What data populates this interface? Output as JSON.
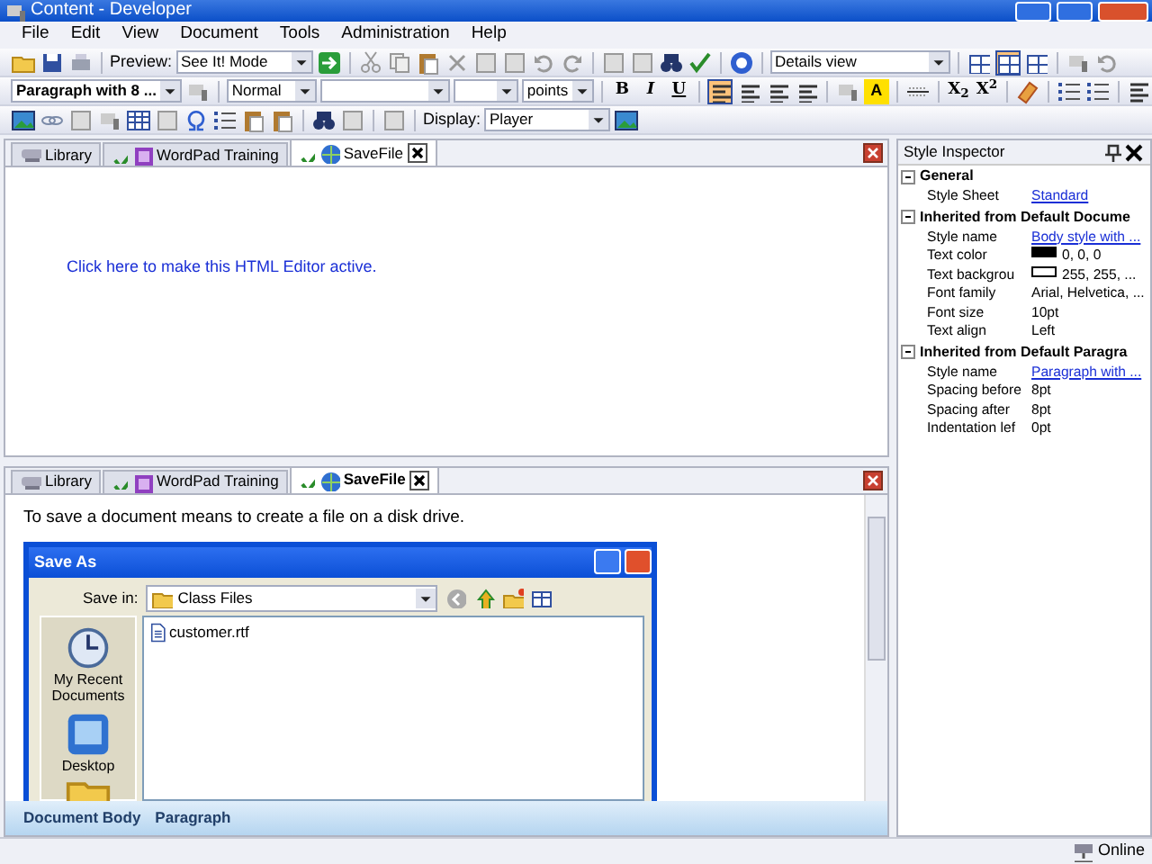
{
  "window": {
    "title": "Content - Developer"
  },
  "menu": [
    "File",
    "Edit",
    "View",
    "Document",
    "Tools",
    "Administration",
    "Help"
  ],
  "toolbar": {
    "preview_label": "Preview:",
    "preview_mode": "See It! Mode",
    "view_select": "Details view",
    "layout_buttons": [
      {
        "selected": false
      },
      {
        "selected": true
      },
      {
        "selected": false
      }
    ]
  },
  "format_bar": {
    "paragraph_style": "Paragraph with 8 ...",
    "style": "Normal",
    "unit": "points",
    "format_buttons": [
      "B",
      "I",
      "U"
    ],
    "align_buttons": [
      {
        "selected": true
      },
      {
        "selected": false
      },
      {
        "selected": false
      },
      {
        "selected": false
      }
    ],
    "font_color_button": "A",
    "subscript_button": "X$_{2}$",
    "superscript_button": "X$^{2}$"
  },
  "insert_bar": {
    "display_label": "Display:",
    "display_value": "Player"
  },
  "top_pane": {
    "tabs": [
      {
        "label": "Library",
        "checked": false,
        "selected": false
      },
      {
        "label": "WordPad Training",
        "checked": true,
        "selected": false
      },
      {
        "label": "SaveFile",
        "checked": true,
        "selected": true
      }
    ],
    "link": "Click here to make this HTML Editor active."
  },
  "bottom_pane": {
    "tabs": [
      {
        "label": "Library",
        "checked": false,
        "selected": false
      },
      {
        "label": "WordPad Training",
        "checked": true,
        "selected": false
      },
      {
        "label": "SaveFile",
        "checked": true,
        "selected": true
      }
    ],
    "text": "To save a document means to create a file on a disk drive.",
    "dialog": {
      "title": "Save As",
      "save_in_label": "Save in:",
      "folder": "Class Files",
      "places": [
        "My Recent Documents",
        "Desktop"
      ],
      "files": [
        "customer.rtf"
      ]
    },
    "breadcrumb": [
      "Document Body",
      "Paragraph"
    ]
  },
  "inspector": {
    "title": "Style Inspector",
    "groups": [
      {
        "title": "General",
        "expanded": true,
        "rows": [
          {
            "label": "Style Sheet",
            "value": "Standard",
            "kind": "link"
          }
        ]
      },
      {
        "title": "Inherited from Default Docume",
        "expanded": true,
        "rows": [
          {
            "label": "Style name",
            "value": "Body style with ...",
            "kind": "link"
          },
          {
            "label": "Text color",
            "value": "0, 0, 0",
            "kind": "swatch",
            "color": "#000000"
          },
          {
            "label": "Text backgrou",
            "value": "255, 255, ...",
            "kind": "swatch",
            "color": "#ffffff"
          },
          {
            "label": "Font family",
            "value": "Arial, Helvetica, ...",
            "kind": "text"
          },
          {
            "label": "Font size",
            "value": "10pt",
            "kind": "text"
          },
          {
            "label": "Text align",
            "value": "Left",
            "kind": "text"
          }
        ]
      },
      {
        "title": "Inherited from Default Paragra",
        "expanded": true,
        "rows": [
          {
            "label": "Style name",
            "value": "Paragraph with ...",
            "kind": "link"
          },
          {
            "label": "Spacing before",
            "value": "8pt",
            "kind": "text"
          },
          {
            "label": "Spacing after",
            "value": "8pt",
            "kind": "text"
          },
          {
            "label": "Indentation lef",
            "value": "0pt",
            "kind": "text"
          }
        ]
      }
    ]
  },
  "status_bar": {
    "connection": "Online"
  }
}
